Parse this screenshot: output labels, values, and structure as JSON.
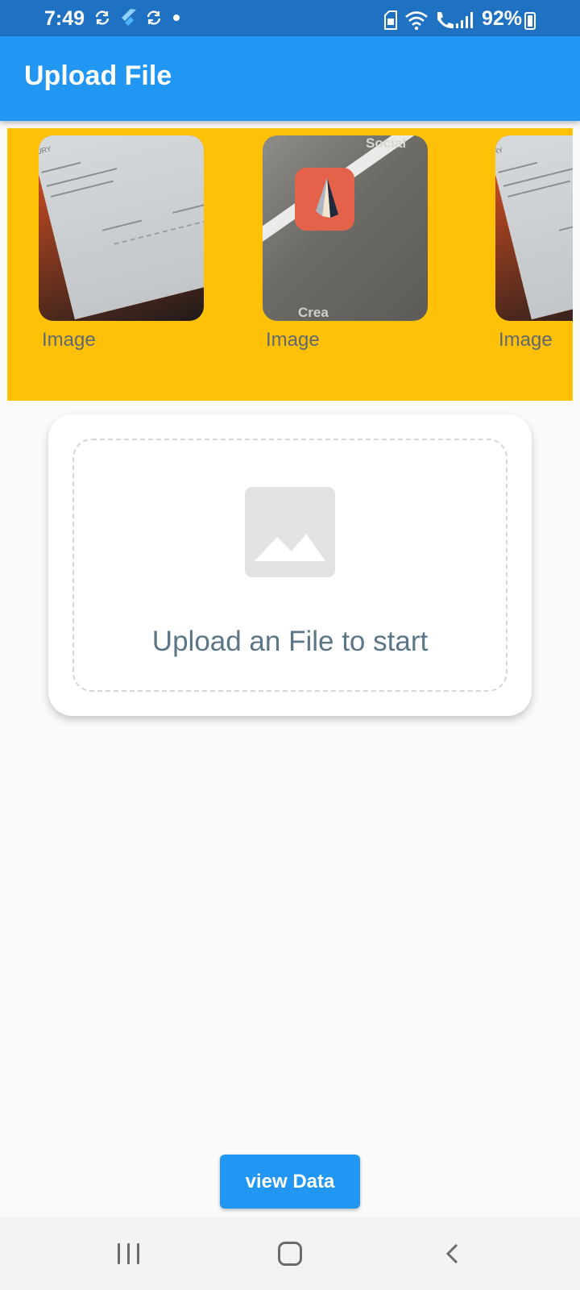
{
  "status_bar": {
    "time": "7:49",
    "battery": "92%",
    "icons": [
      "sync-icon",
      "flutter-icon",
      "sync-icon",
      "dot-icon",
      "sim-icon",
      "wifi-icon",
      "wifi-calling-icon",
      "signal-icon",
      "battery-icon"
    ]
  },
  "app_bar": {
    "title": "Upload File"
  },
  "carousel": {
    "background": "#ffc107",
    "items": [
      {
        "label": "Image",
        "thumb_text": "URY"
      },
      {
        "label": "Image",
        "thumb_text": "Social",
        "thumb_text_2": "Crea"
      },
      {
        "label": "Image",
        "thumb_text": "RY"
      }
    ]
  },
  "upload": {
    "prompt": "Upload an File to start"
  },
  "actions": {
    "view_data_label": "view Data"
  },
  "colors": {
    "primary": "#2196f3",
    "status_bar": "#1f72c2",
    "accent": "#ffc107"
  }
}
